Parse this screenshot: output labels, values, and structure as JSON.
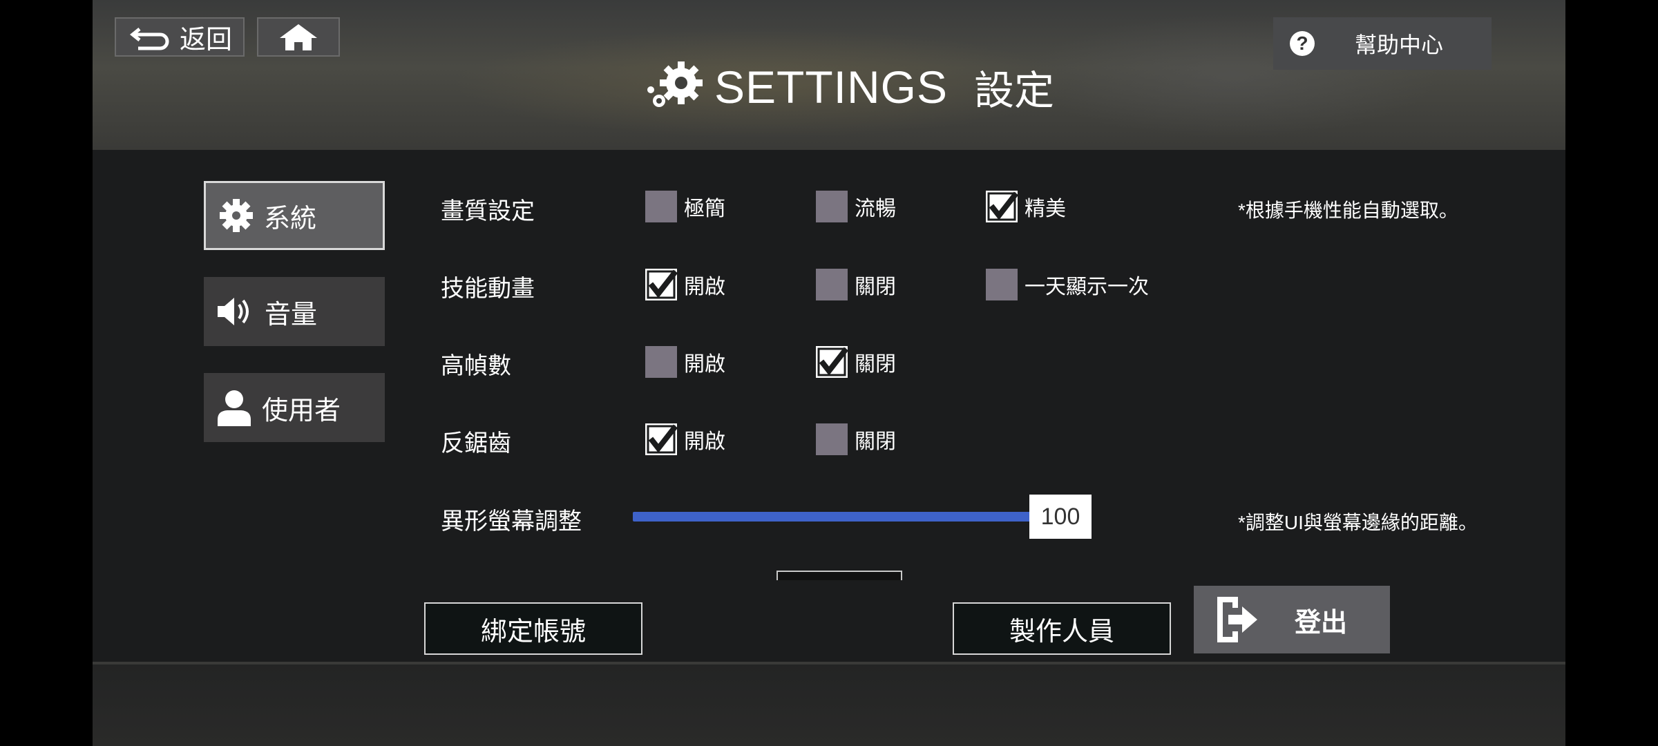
{
  "header": {
    "back_label": "返回",
    "help_label": "幫助中心",
    "title_en": "SETTINGS",
    "title_zh": "設定"
  },
  "sidebar": {
    "items": [
      {
        "label": "系統",
        "icon": "gear-icon",
        "active": true
      },
      {
        "label": "音量",
        "icon": "speaker-icon",
        "active": false
      },
      {
        "label": "使用者",
        "icon": "user-icon",
        "active": false
      }
    ]
  },
  "settings": {
    "quality": {
      "label": "畫質設定",
      "options": [
        "極簡",
        "流暢",
        "精美"
      ],
      "selected": "精美",
      "note": "*根據手機性能自動選取。"
    },
    "skill_anim": {
      "label": "技能動畫",
      "options": [
        "開啟",
        "關閉",
        "一天顯示一次"
      ],
      "selected": "開啟"
    },
    "high_fps": {
      "label": "高幀數",
      "options": [
        "開啟",
        "關閉"
      ],
      "selected": "關閉"
    },
    "antialias": {
      "label": "反鋸齒",
      "options": [
        "開啟",
        "關閉"
      ],
      "selected": "開啟"
    },
    "notch": {
      "label": "異形螢幕調整",
      "value": "100",
      "note": "*調整UI與螢幕邊緣的距離。"
    }
  },
  "footer": {
    "bind_label": "綁定帳號",
    "credits_label": "製作人員",
    "logout_label": "登出"
  },
  "colors": {
    "slider": "#3e62c9",
    "checkbox_off": "#7b7581"
  }
}
